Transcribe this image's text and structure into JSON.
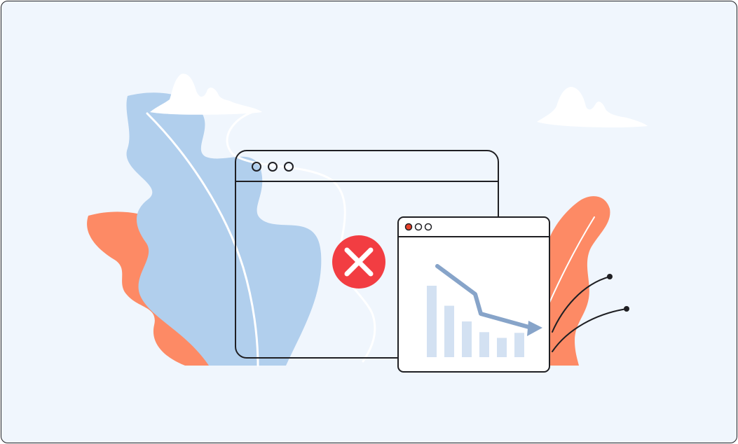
{
  "illustration": {
    "colors": {
      "background": "#f0f6fd",
      "blue_leaf": "#b1cfed",
      "orange_leaf": "#fd8a65",
      "outline": "#1f1f23",
      "error_red": "#f23d42",
      "trend_arrow": "#87a4c9",
      "bars": "#d3e1f2",
      "cloud": "#ffffff",
      "dot_active": "#e8412a"
    },
    "icons": {
      "error": "close-x-circle-icon",
      "trend": "arrow-down-trend-icon"
    },
    "mini_chart": {
      "bar_levels": [
        1.0,
        0.72,
        0.5,
        0.35,
        0.27,
        0.34
      ],
      "trend": "decreasing"
    }
  }
}
